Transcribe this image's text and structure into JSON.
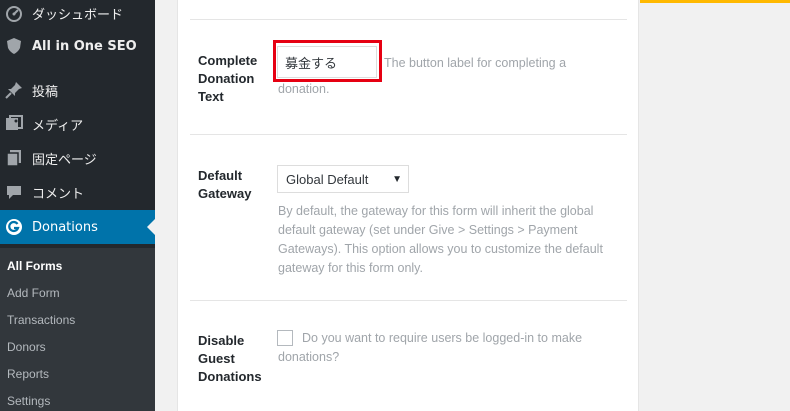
{
  "sidebar": {
    "items": [
      {
        "label": "ダッシュボード",
        "icon": "dashboard-icon"
      },
      {
        "label": "All in One SEO",
        "icon": "shield-icon"
      },
      {
        "label": "投稿",
        "icon": "pin-icon"
      },
      {
        "label": "メディア",
        "icon": "media-icon"
      },
      {
        "label": "固定ページ",
        "icon": "pages-icon"
      },
      {
        "label": "コメント",
        "icon": "comment-icon"
      },
      {
        "label": "Donations",
        "icon": "give-icon"
      }
    ],
    "submenu": [
      "All Forms",
      "Add Form",
      "Transactions",
      "Donors",
      "Reports",
      "Settings"
    ],
    "colors": {
      "bg": "#23282d",
      "active": "#0073aa",
      "submenu_bg": "#32373c"
    }
  },
  "form": {
    "complete_text": {
      "label_lines": [
        "Complete",
        "Donation",
        "Text"
      ],
      "value": "募金する",
      "desc_lines": [
        "The button label for completing a",
        "donation."
      ]
    },
    "gateway": {
      "label_lines": [
        "Default",
        "Gateway"
      ],
      "selected": "Global Default",
      "desc_lines": [
        "By default, the gateway for this form will inherit the global",
        "default gateway (set under Give > Settings > Payment",
        "Gateways). This option allows you to customize the default",
        "gateway for this form only."
      ]
    },
    "guest": {
      "label_lines": [
        "Disable",
        "Guest",
        "Donations"
      ],
      "desc_lines": [
        "Do you want to require users be logged-in to make",
        "donations?"
      ],
      "checked": false
    }
  },
  "highlight_color": "#e60012"
}
